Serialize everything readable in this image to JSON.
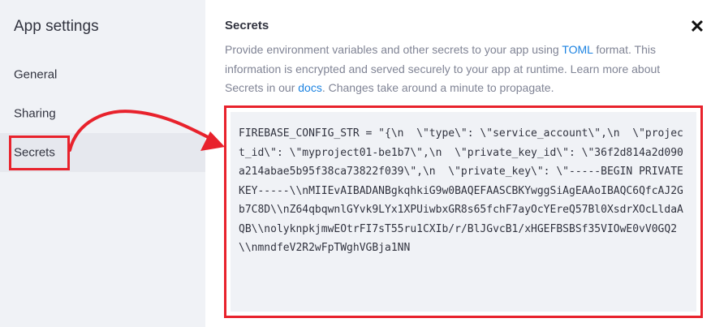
{
  "sidebar": {
    "title": "App settings",
    "items": [
      {
        "label": "General"
      },
      {
        "label": "Sharing"
      },
      {
        "label": "Secrets"
      }
    ]
  },
  "main": {
    "title": "Secrets",
    "close_glyph": "✕",
    "description": {
      "p1": "Provide environment variables and other secrets to your app using ",
      "link1": "TOML",
      "p2": " format. This information is encrypted and served securely to your app at runtime. Learn more about Secrets in our ",
      "link2": "docs",
      "p3": ". Changes take around a minute to propagate."
    },
    "editor_text": "FIREBASE_CONFIG_STR = \"{\\n  \\\"type\\\": \\\"service_account\\\",\\n  \\\"project_id\\\": \\\"myproject01-be1b7\\\",\\n  \\\"private_key_id\\\": \\\"36f2d814a2d090a214abae5b95f38ca73822f039\\\",\\n  \\\"private_key\\\": \\\"-----BEGIN PRIVATE KEY-----\\\\nMIIEvAIBADANBgkqhkiG9w0BAQEFAASCBKYwggSiAgEAAoIBAQC6QfcAJ2Gb7C8D\\\\nZ64qbqwnlGYvk9LYx1XPUiwbxGR8s65fchF7ayOcYEreQ57Bl0XsdrXOcLldaAQB\\\\nolyknpkjmwEOtrFI7sT55ru1CXIb/r/BlJGvcB1/xHGEFBSBSf35VIOwE0vV0GQ2\\\\nmndfeV2R2wFpTWghVGBja1NN"
  },
  "colors": {
    "annotation_red": "#e8222c",
    "link_blue": "#1c83e1",
    "sidebar_bg": "#f0f2f6"
  },
  "icons": {
    "close": "close-icon",
    "annotation": "red-arrow"
  }
}
